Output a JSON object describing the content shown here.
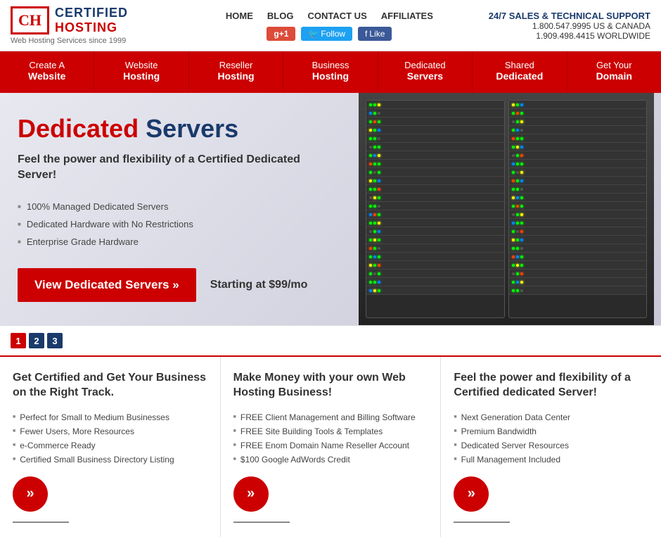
{
  "header": {
    "logo_ch": "CH",
    "logo_certified": "CERTIFIED",
    "logo_hosting": "HOSTING",
    "logo_tagline": "Web Hosting Services since 1999",
    "nav_links": [
      "HOME",
      "BLOG",
      "CONTACT US",
      "AFFILIATES"
    ],
    "social": {
      "gplus_label": "g+1",
      "twitter_label": "Follow",
      "facebook_label": "Like"
    },
    "support_title": "24/7 SALES & TECHNICAL SUPPORT",
    "phone_us": "1.800.547.9995 US & CANADA",
    "phone_world": "1.909.498.4415 WORLDWIDE"
  },
  "navbar": {
    "items": [
      {
        "line1": "Create A",
        "line2": "Website"
      },
      {
        "line1": "Website",
        "line2": "Hosting"
      },
      {
        "line1": "Reseller",
        "line2": "Hosting"
      },
      {
        "line1": "Business",
        "line2": "Hosting"
      },
      {
        "line1": "Dedicated",
        "line2": "Servers"
      },
      {
        "line1": "Shared",
        "line2": "Dedicated"
      },
      {
        "line1": "Get Your",
        "line2": "Domain"
      }
    ]
  },
  "hero": {
    "title_red": "Dedicated",
    "title_dark": " Servers",
    "subtitle": "Feel the power and flexibility of a Certified Dedicated Server!",
    "features": [
      "100% Managed Dedicated Servers",
      "Dedicated Hardware with No Restrictions",
      "Enterprise Grade Hardware"
    ],
    "cta_button": "View Dedicated Servers »",
    "starting_price": "Starting at $99/mo"
  },
  "slider": {
    "dots": [
      "1",
      "2",
      "3"
    ],
    "active": 0
  },
  "columns": [
    {
      "title": "Get Certified and Get Your Business on the Right Track.",
      "items": [
        "Perfect for Small to Medium Businesses",
        "Fewer Users, More Resources",
        "e-Commerce Ready",
        "Certified Small Business Directory Listing"
      ]
    },
    {
      "title": "Make Money with your own Web Hosting Business!",
      "items": [
        "FREE Client Management and Billing Software",
        "FREE Site Building Tools & Templates",
        "FREE Enom Domain Name Reseller Account",
        "$100 Google AdWords Credit"
      ]
    },
    {
      "title": "Feel the power and flexibility of a Certified dedicated Server!",
      "items": [
        "Next Generation Data Center",
        "Premium Bandwidth",
        "Dedicated Server Resources",
        "Full Management Included"
      ]
    }
  ]
}
